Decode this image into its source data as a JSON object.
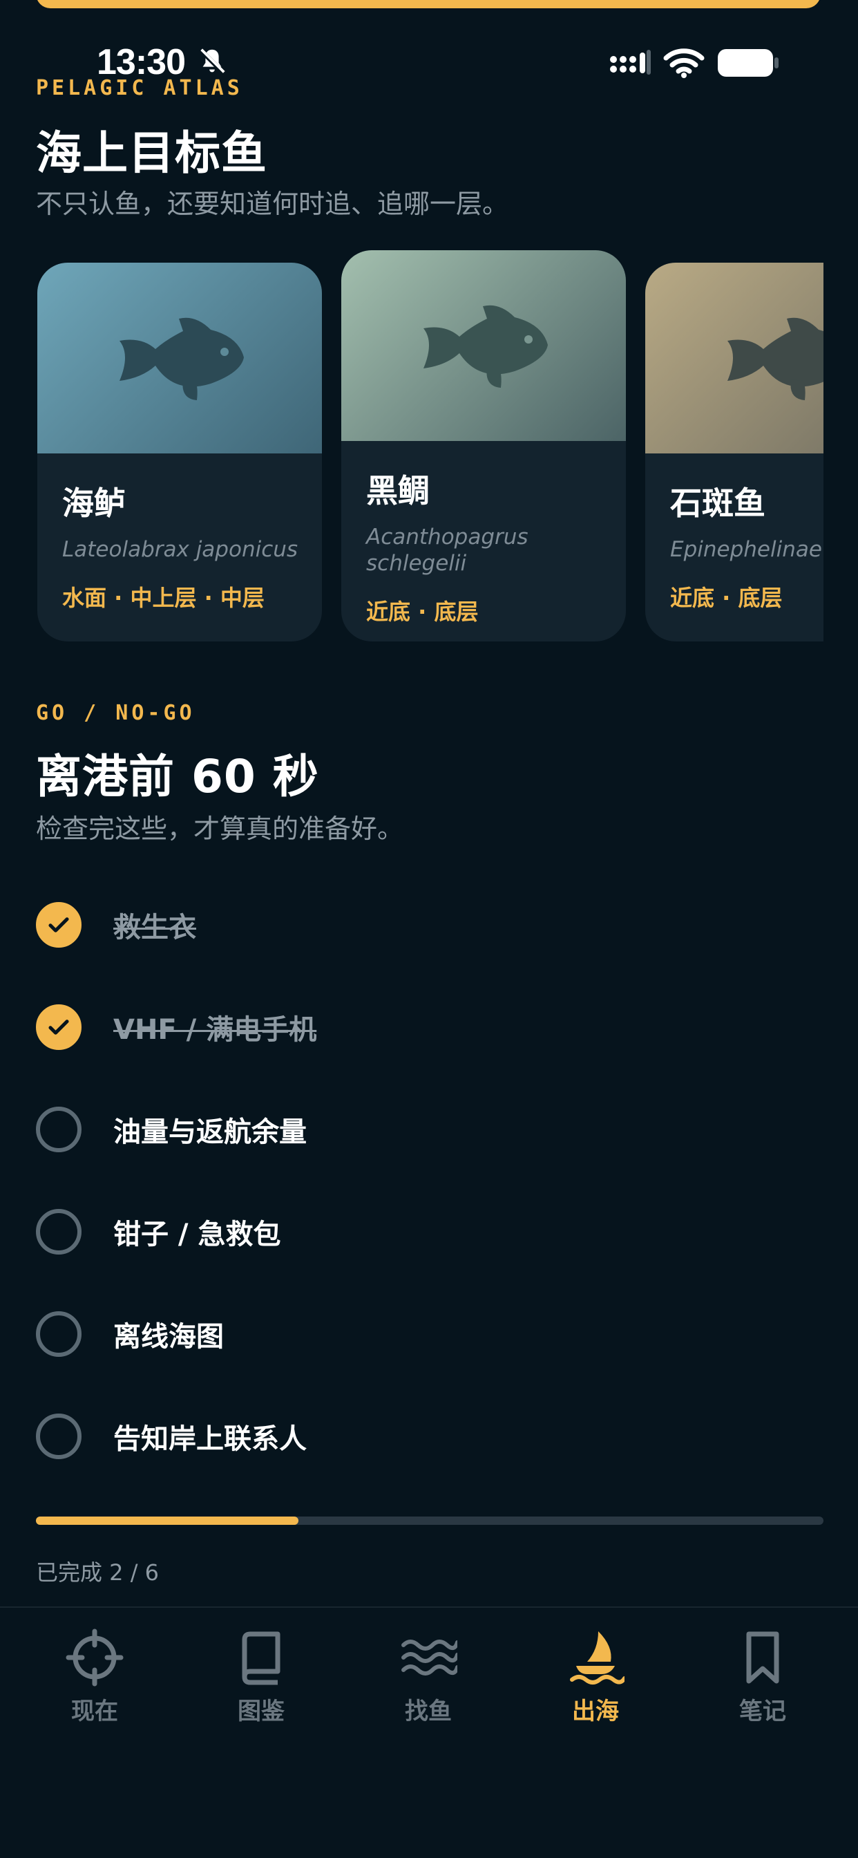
{
  "status_bar": {
    "time": "13:30"
  },
  "fish_section": {
    "eyebrow": "PELAGIC ATLAS",
    "title": "海上目标鱼",
    "subtitle": "不只认鱼，还要知道何时追、追哪一层。",
    "cards": [
      {
        "name": "海鲈",
        "latin": "Lateolabrax japonicus",
        "layers": "水面 · 中上层 · 中层",
        "gradient": [
          "#6fa6b9",
          "#3f6677"
        ]
      },
      {
        "name": "黑鲷",
        "latin": "Acanthopagrus schlegelii",
        "layers": "近底 · 底层",
        "gradient": [
          "#a3bfae",
          "#4c6466"
        ]
      },
      {
        "name": "石斑鱼",
        "latin": "Epinephelinae",
        "layers": "近底 · 底层",
        "gradient": [
          "#b9aa85",
          "#6e6c60"
        ]
      }
    ]
  },
  "checklist_section": {
    "eyebrow": "GO / NO-GO",
    "title": "离港前 60 秒",
    "subtitle": "检查完这些，才算真的准备好。",
    "items": [
      {
        "label": "救生衣",
        "checked": true
      },
      {
        "label": "VHF / 满电手机",
        "checked": true
      },
      {
        "label": "油量与返航余量",
        "checked": false
      },
      {
        "label": "钳子 / 急救包",
        "checked": false
      },
      {
        "label": "离线海图",
        "checked": false
      },
      {
        "label": "告知岸上联系人",
        "checked": false
      }
    ],
    "progress_fraction": 0.3333,
    "progress_text": "已完成 2 / 6"
  },
  "tabbar": {
    "tabs": [
      {
        "label": "现在",
        "icon": "crosshair-icon",
        "active": false
      },
      {
        "label": "图鉴",
        "icon": "book-icon",
        "active": false
      },
      {
        "label": "找鱼",
        "icon": "waves-icon",
        "active": false
      },
      {
        "label": "出海",
        "icon": "sailboat-icon",
        "active": true
      },
      {
        "label": "笔记",
        "icon": "bookmark-icon",
        "active": false
      }
    ]
  },
  "colors": {
    "accent": "#f3b84e",
    "background": "#06141d",
    "card": "#13232e",
    "muted": "#8e9aa3"
  }
}
